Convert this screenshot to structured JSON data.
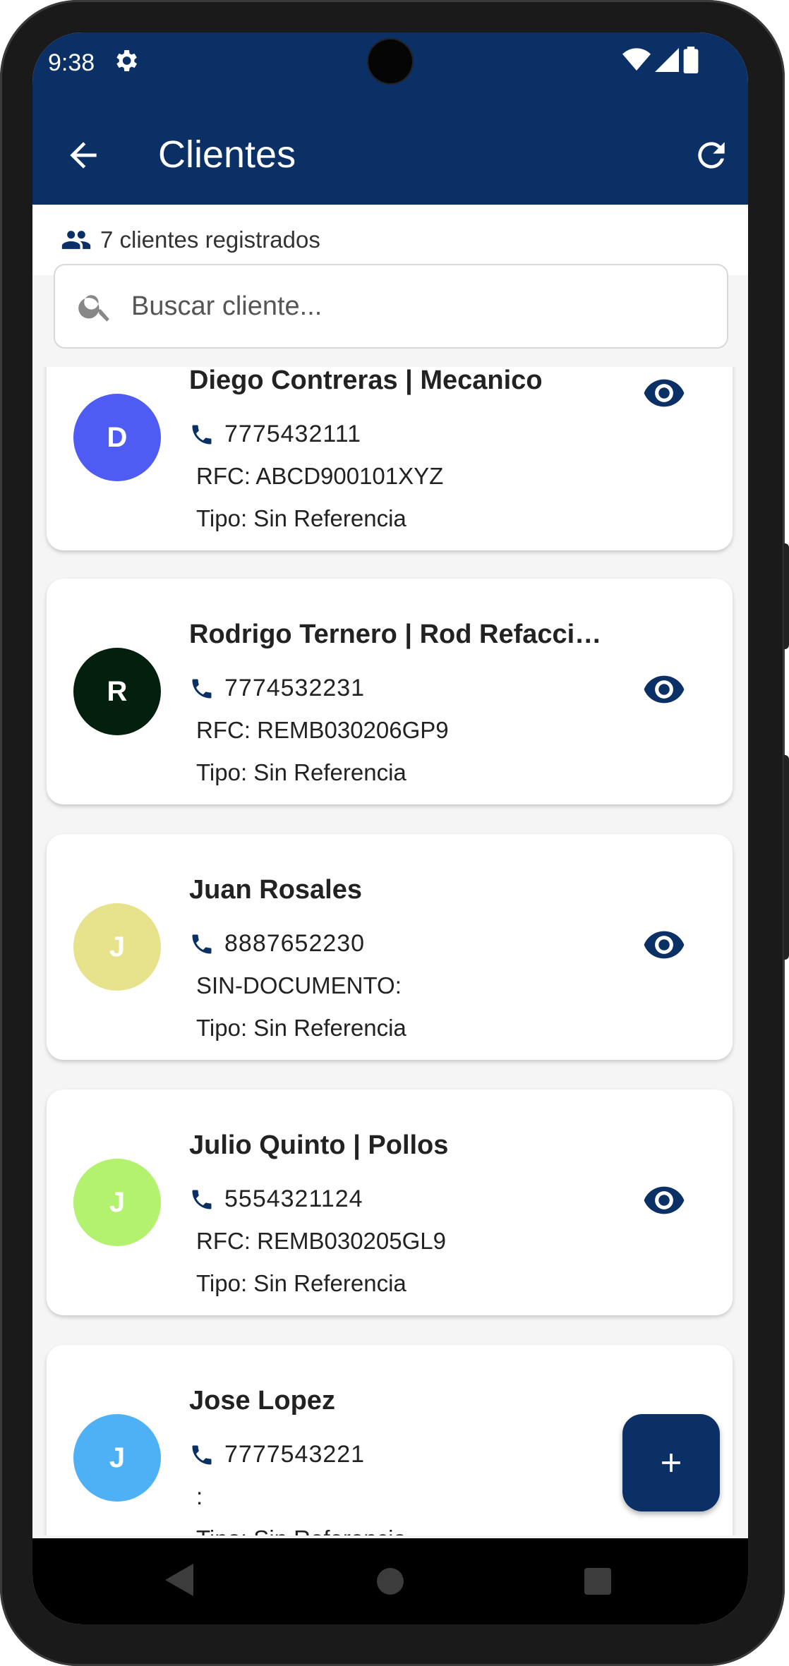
{
  "status": {
    "time": "9:38"
  },
  "appbar": {
    "title": "Clientes"
  },
  "summary": {
    "count_text": "7 clientes registrados"
  },
  "search": {
    "placeholder": "Buscar cliente..."
  },
  "clients": [
    {
      "initial": "D",
      "name": "Diego Contreras | Mecanico",
      "phone": "7775432111",
      "doc": "RFC: ABCD900101XYZ",
      "tipo": "Tipo: Sin Referencia",
      "avatar_color": "#4f5cf4"
    },
    {
      "initial": "R",
      "name": "Rodrigo Ternero | Rod Refacciones",
      "phone": "7774532231",
      "doc": "RFC: REMB030206GP9",
      "tipo": "Tipo: Sin Referencia",
      "avatar_color": "#03200e"
    },
    {
      "initial": "J",
      "name": "Juan Rosales",
      "phone": "8887652230",
      "doc": "SIN-DOCUMENTO:",
      "tipo": "Tipo: Sin Referencia",
      "avatar_color": "#e6e38c"
    },
    {
      "initial": "J",
      "name": "Julio Quinto | Pollos",
      "phone": "5554321124",
      "doc": "RFC: REMB030205GL9",
      "tipo": "Tipo: Sin Referencia",
      "avatar_color": "#b3f26e"
    },
    {
      "initial": "J",
      "name": "Jose Lopez",
      "phone": "7777543221",
      "doc": ":",
      "tipo": "Tipo: Sin Referencia",
      "avatar_color": "#4fb1f5"
    }
  ],
  "colors": {
    "primary": "#0a3066",
    "icon": "#0a3066"
  },
  "icons": {
    "back": "arrow-left-icon",
    "refresh": "refresh-icon",
    "people": "people-icon",
    "search": "search-icon",
    "phone": "phone-icon",
    "view": "eye-icon",
    "add": "plus-icon"
  }
}
